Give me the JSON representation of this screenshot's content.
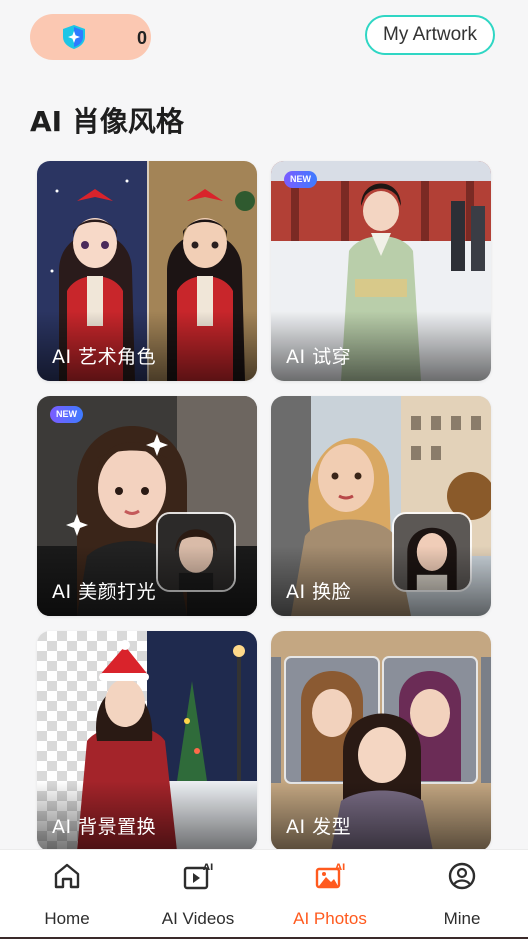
{
  "header": {
    "credits_count": "0",
    "artwork_label": "My Artwork"
  },
  "section_title": "AI 肖像风格",
  "cards": [
    {
      "label": "AI 艺术角色",
      "is_new": false
    },
    {
      "label": "AI 试穿",
      "is_new": true
    },
    {
      "label": "AI 美颜打光",
      "is_new": true
    },
    {
      "label": "AI 换脸",
      "is_new": false
    },
    {
      "label": "AI 背景置换",
      "is_new": false
    },
    {
      "label": "AI 发型",
      "is_new": false
    }
  ],
  "new_badge": "NEW",
  "nav": {
    "items": [
      {
        "label": "Home",
        "icon": "home-icon"
      },
      {
        "label": "AI Videos",
        "icon": "ai-video-icon"
      },
      {
        "label": "AI Photos",
        "icon": "ai-photo-icon",
        "active": true
      },
      {
        "label": "Mine",
        "icon": "user-icon"
      }
    ],
    "active_color": "#ff5a1e"
  }
}
